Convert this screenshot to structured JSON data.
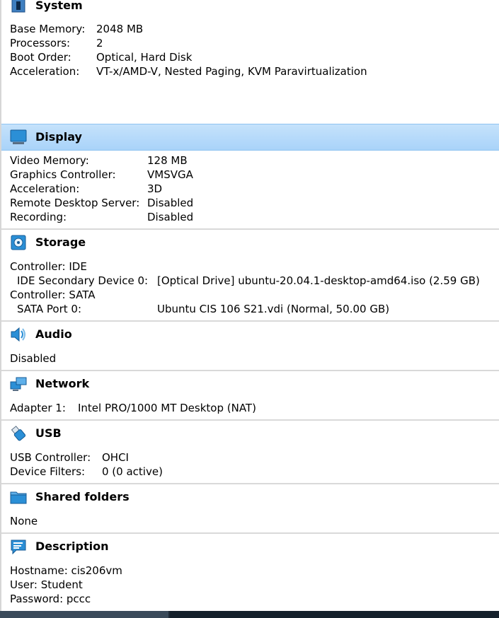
{
  "system": {
    "title": "System",
    "rows": [
      {
        "label": "Base Memory:",
        "value": "2048 MB"
      },
      {
        "label": "Processors:",
        "value": "2"
      },
      {
        "label": "Boot Order:",
        "value": "Optical, Hard Disk"
      },
      {
        "label": "Acceleration:",
        "value": "VT-x/AMD-V, Nested Paging, KVM Paravirtualization"
      }
    ]
  },
  "display": {
    "title": "Display",
    "rows": [
      {
        "label": "Video Memory:",
        "value": "128 MB"
      },
      {
        "label": "Graphics Controller:",
        "value": "VMSVGA"
      },
      {
        "label": "Acceleration:",
        "value": "3D"
      },
      {
        "label": "Remote Desktop Server:",
        "value": "Disabled"
      },
      {
        "label": "Recording:",
        "value": "Disabled"
      }
    ]
  },
  "storage": {
    "title": "Storage",
    "rows": [
      {
        "label": "Controller: IDE",
        "value": ""
      },
      {
        "label": "IDE Secondary Device 0:",
        "value": "[Optical Drive] ubuntu-20.04.1-desktop-amd64.iso (2.59 GB)"
      },
      {
        "label": "Controller: SATA",
        "value": ""
      },
      {
        "label": "SATA Port 0:",
        "value": "Ubuntu CIS 106 S21.vdi (Normal, 50.00 GB)"
      }
    ]
  },
  "audio": {
    "title": "Audio",
    "rows": [
      {
        "label": "Disabled",
        "value": ""
      }
    ]
  },
  "network": {
    "title": "Network",
    "rows": [
      {
        "label": "Adapter 1:",
        "value": "Intel PRO/1000 MT Desktop (NAT)"
      }
    ]
  },
  "usb": {
    "title": "USB",
    "rows": [
      {
        "label": "USB Controller:",
        "value": "OHCI"
      },
      {
        "label": "Device Filters:",
        "value": "0 (0 active)"
      }
    ]
  },
  "shared_folders": {
    "title": "Shared folders",
    "rows": [
      {
        "label": "None",
        "value": ""
      }
    ]
  },
  "description": {
    "title": "Description",
    "rows": [
      {
        "label": "Hostname: cis206vm",
        "value": ""
      },
      {
        "label": "User: Student",
        "value": ""
      },
      {
        "label": "Password: pccc",
        "value": ""
      }
    ]
  },
  "colors": {
    "selected_header": "#a9d3f9",
    "divider": "#d9d9d9",
    "icon_blue": "#2b8fd6"
  },
  "icons": {
    "system": "chip-icon",
    "display": "monitor-icon",
    "storage": "disk-icon",
    "audio": "speaker-icon",
    "network": "network-icon",
    "usb": "usb-icon",
    "shared_folders": "folder-icon",
    "description": "speech-bubble-icon"
  }
}
